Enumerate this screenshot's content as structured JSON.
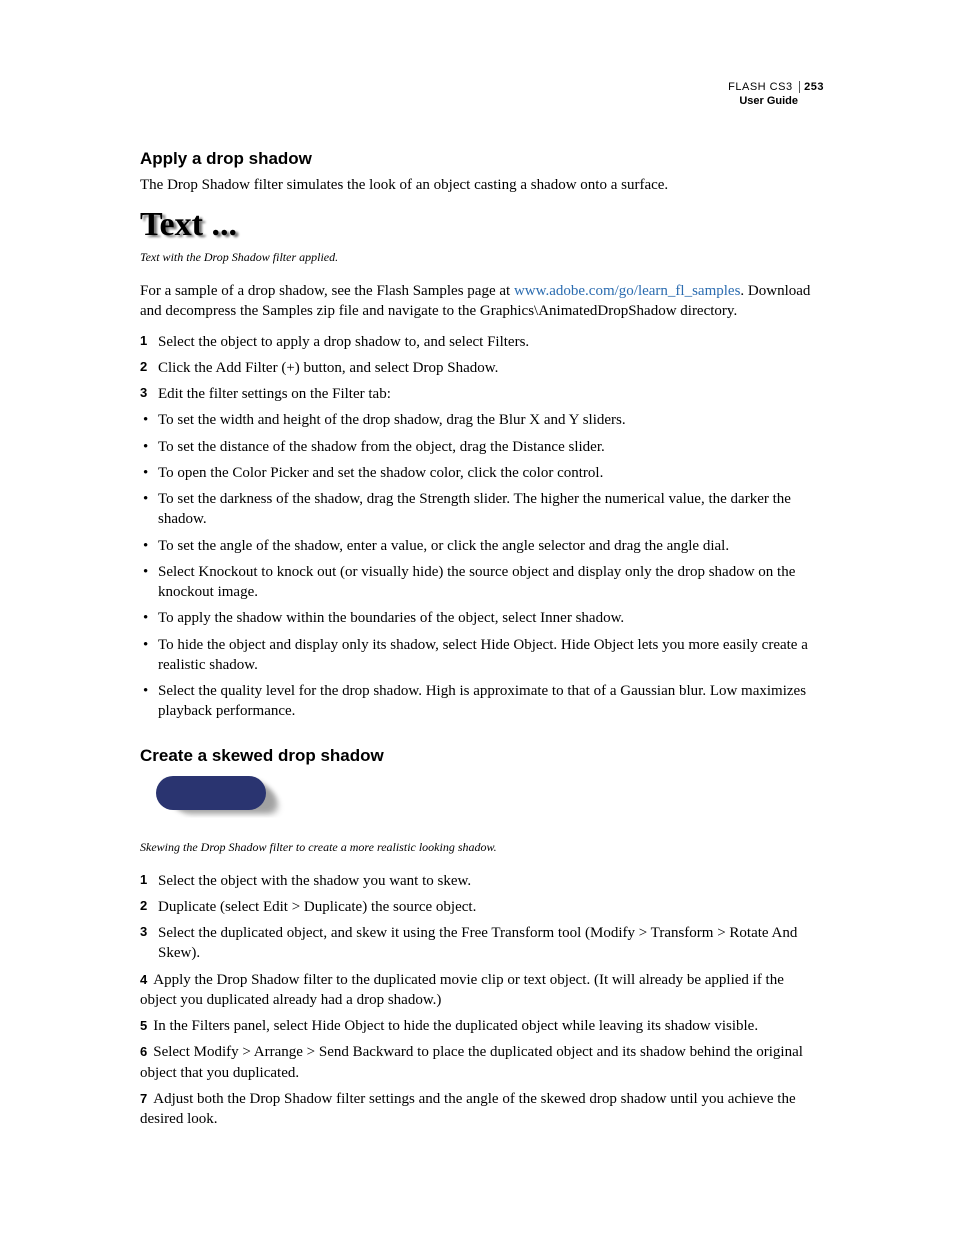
{
  "header": {
    "product": "FLASH CS3",
    "page_number": "253",
    "guide": "User Guide"
  },
  "section1": {
    "title": "Apply a drop shadow",
    "intro": "The Drop Shadow filter simulates the look of an object casting a shadow onto a surface.",
    "image_text": "Text ...",
    "caption": "Text with the Drop Shadow filter applied.",
    "para2_pre": "For a sample of a drop shadow, see the Flash Samples page at ",
    "para2_link": "www.adobe.com/go/learn_fl_samples",
    "para2_post": ". Download and decompress the Samples zip file and navigate to the Graphics\\AnimatedDropShadow directory.",
    "steps": [
      "Select the object to apply a drop shadow to, and select Filters.",
      "Click the Add Filter (+) button, and select Drop Shadow.",
      "Edit the filter settings on the Filter tab:"
    ],
    "bullets": [
      "To set the width and height of the drop shadow, drag the Blur X and Y sliders.",
      "To set the distance of the shadow from the object, drag the Distance slider.",
      "To open the Color Picker and set the shadow color, click the color control.",
      "To set the darkness of the shadow, drag the Strength slider. The higher the numerical value, the darker the shadow.",
      "To set the angle of the shadow, enter a value, or click the angle selector and drag the angle dial.",
      "Select Knockout to knock out (or visually hide) the source object and display only the drop shadow on the knockout image.",
      "To apply the shadow within the boundaries of the object, select Inner shadow.",
      "To hide the object and display only its shadow, select Hide Object. Hide Object lets you more easily create a realistic shadow.",
      "Select the quality level for the drop shadow. High is approximate to that of a Gaussian blur. Low maximizes playback performance."
    ]
  },
  "section2": {
    "title": "Create a skewed drop shadow",
    "caption": "Skewing the Drop Shadow filter to create a more realistic looking shadow.",
    "steps": [
      "Select the object with the shadow you want to skew.",
      "Duplicate (select Edit > Duplicate) the source object.",
      "Select the duplicated object, and skew it using the Free Transform tool (Modify > Transform > Rotate And Skew).",
      "Apply the Drop Shadow filter to the duplicated movie clip or text object. (It will already be applied if the object you duplicated already had a drop shadow.)",
      "In the Filters panel, select Hide Object to hide the duplicated object while leaving its shadow visible.",
      "Select Modify > Arrange > Send Backward to place the duplicated object and its shadow behind the original object that you duplicated.",
      "Adjust both the Drop Shadow filter settings and the angle of the skewed drop shadow until you achieve the desired look."
    ]
  }
}
